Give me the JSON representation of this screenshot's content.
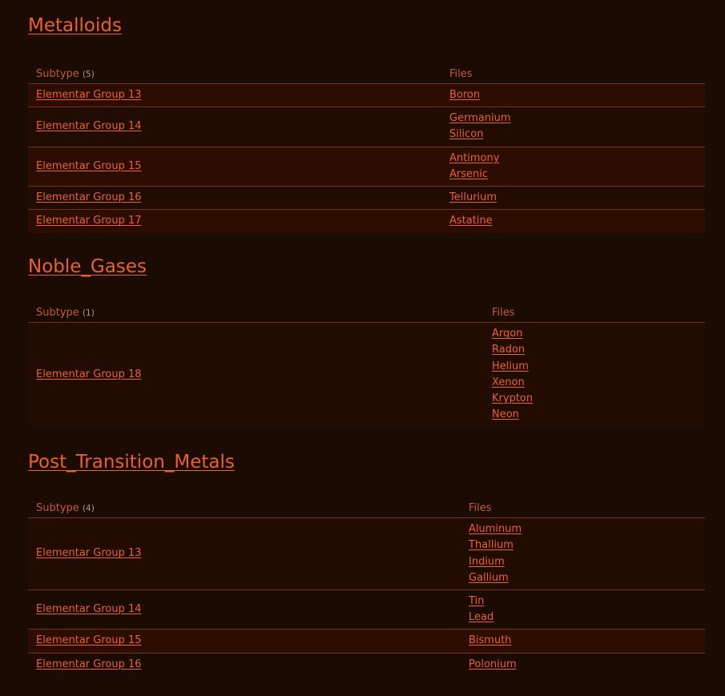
{
  "sections": [
    {
      "title": "Metalloids",
      "subtype_label": "Subtype",
      "count": "(5)",
      "files_label": "Files",
      "rows": [
        {
          "subtype": "Elementar Group 13",
          "files": [
            "Boron"
          ]
        },
        {
          "subtype": "Elementar Group 14",
          "files": [
            "Germanium",
            "Silicon"
          ]
        },
        {
          "subtype": "Elementar Group 15",
          "files": [
            "Antimony",
            "Arsenic"
          ]
        },
        {
          "subtype": "Elementar Group 16",
          "files": [
            "Tellurium"
          ]
        },
        {
          "subtype": "Elementar Group 17",
          "files": [
            "Astatine"
          ]
        }
      ]
    },
    {
      "title": "Noble_Gases",
      "subtype_label": "Subtype",
      "count": "(1)",
      "files_label": "Files",
      "rows": [
        {
          "subtype": "Elementar Group 18",
          "files": [
            "Argon",
            "Radon",
            "Helium",
            "Xenon",
            "Krypton",
            "Neon"
          ]
        }
      ]
    },
    {
      "title": "Post_Transition_Metals",
      "subtype_label": "Subtype",
      "count": "(4)",
      "files_label": "Files",
      "rows": [
        {
          "subtype": "Elementar Group 13",
          "files": [
            "Aluminum",
            "Thallium",
            "Indium",
            "Gallium"
          ]
        },
        {
          "subtype": "Elementar Group 14",
          "files": [
            "Tin",
            "Lead"
          ]
        },
        {
          "subtype": "Elementar Group 15",
          "files": [
            "Bismuth"
          ]
        },
        {
          "subtype": "Elementar Group 16",
          "files": [
            "Polonium"
          ]
        }
      ]
    }
  ],
  "colors": {
    "background": "#1b0b02",
    "link": "#e8622a",
    "header_text": "#bf5e35",
    "row_even": "#2d0d02",
    "row_odd": "#220c02",
    "divider": "#6e3417"
  }
}
